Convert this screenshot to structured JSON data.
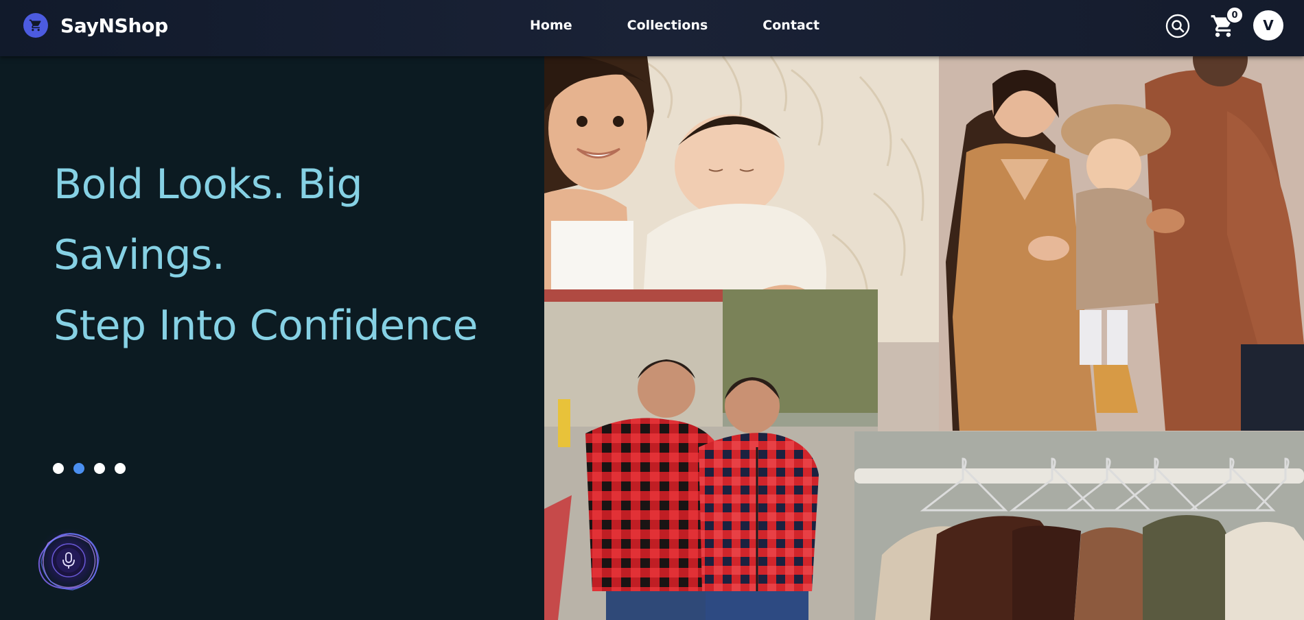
{
  "brand": {
    "name": "SayNShop",
    "logo_icon": "shopping-cart-icon",
    "logo_color": "#4c5be0"
  },
  "nav": {
    "links": [
      "Home",
      "Collections",
      "Contact"
    ]
  },
  "header_actions": {
    "search_icon": "search-icon",
    "cart_icon": "shopping-cart-icon",
    "cart_count": "0",
    "avatar_initial": "V"
  },
  "hero": {
    "headline_lines": [
      "Bold Looks. Big",
      "Savings.",
      "Step Into Confidence"
    ],
    "headline_color": "#86d1e4",
    "slides": {
      "count": 4,
      "active_index": 1
    },
    "voice_button_icon": "microphone-icon"
  },
  "collage": {
    "photos": [
      "newborn-with-sister-photo",
      "family-with-baby-photo",
      "twin-boys-plaid-jackets-photo",
      "clothes-on-hangers-photo"
    ]
  },
  "colors": {
    "background": "#0c1b22",
    "navbar": "#1a2236",
    "dot_active": "#4b8ff0",
    "dot_inactive": "#ffffff"
  }
}
